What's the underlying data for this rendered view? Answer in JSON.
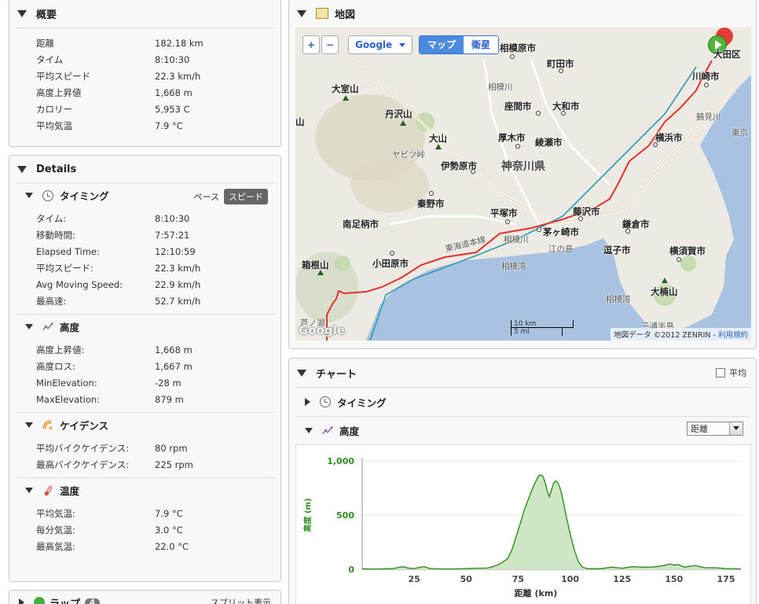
{
  "summary": {
    "title": "概要",
    "rows": [
      {
        "k": "距離",
        "v": "182.18 km"
      },
      {
        "k": "タイム",
        "v": "8:10:30"
      },
      {
        "k": "平均スピード",
        "v": "22.3 km/h"
      },
      {
        "k": "高度上昇値",
        "v": "1,668 m"
      },
      {
        "k": "カロリー",
        "v": "5,953 C"
      },
      {
        "k": "平均気温",
        "v": "7.9 °C"
      }
    ]
  },
  "details": {
    "title": "Details",
    "timing": {
      "name": "タイミング",
      "pace_label": "ペース",
      "speed_label": "スピード",
      "rows": [
        {
          "k": "タイム:",
          "v": "8:10:30"
        },
        {
          "k": "移動時間:",
          "v": "7:57:21"
        },
        {
          "k": "Elapsed Time:",
          "v": "12:10:59"
        },
        {
          "k": "平均スピード:",
          "v": "22.3 km/h"
        },
        {
          "k": "Avg Moving Speed:",
          "v": "22.9 km/h"
        },
        {
          "k": "最高速:",
          "v": "52.7 km/h"
        }
      ]
    },
    "elevation": {
      "name": "高度",
      "rows": [
        {
          "k": "高度上昇値:",
          "v": "1,668 m"
        },
        {
          "k": "高度ロス:",
          "v": "1,667 m"
        },
        {
          "k": "MinElevation:",
          "v": "-28 m"
        },
        {
          "k": "MaxElevation:",
          "v": "879 m"
        }
      ]
    },
    "cadence": {
      "name": "ケイデンス",
      "rows": [
        {
          "k": "平均バイクケイデンス:",
          "v": "80 rpm"
        },
        {
          "k": "最高バイクケイデンス:",
          "v": "225 rpm"
        }
      ]
    },
    "temperature": {
      "name": "温度",
      "rows": [
        {
          "k": "平均気温:",
          "v": "7.9 °C"
        },
        {
          "k": "毎分気温:",
          "v": "3.0 °C"
        },
        {
          "k": "最高気温:",
          "v": "22.0 °C"
        }
      ]
    }
  },
  "laps": {
    "name": "ラップ",
    "count": "4",
    "split_label": "スプリット表示"
  },
  "map": {
    "title": "地図",
    "zoom_in": "+",
    "zoom_out": "−",
    "provider": "Google",
    "type_map": "マップ",
    "type_satellite": "衛星",
    "scale_km": "10 km",
    "scale_mi": "5 mi",
    "attribution_prefix": "地図データ ©2012 ZENRIN - ",
    "attribution_terms": "利用規約",
    "logo": "Google",
    "labels": {
      "sagamihara": "相模原市",
      "machida": "町田市",
      "sagamigawa1": "相模川",
      "oomuroyama": "大室山",
      "zama": "座間市",
      "yamato": "大和市",
      "tanzawa": "丹沢山",
      "tsurumi": "鶴見川",
      "kawasaki": "川崎市",
      "ota": "大田区",
      "tokyo": "東京",
      "oyama": "大山",
      "atsugi": "厚木市",
      "ayase": "綾瀬市",
      "yokohama": "横浜市",
      "yabitsu": "ヤビツ峠",
      "isehara": "伊勢原市",
      "kanagawa": "神奈川県",
      "yama": "山",
      "hadano": "秦野市",
      "hiratsuka": "平塚市",
      "fujisawa": "藤沢市",
      "minamiashigara": "南足柄市",
      "chigasaki": "茅ヶ崎市",
      "kamakura": "鎌倉市",
      "tokaido": "東海道本線",
      "sagamigawa2": "相模川",
      "enoshima": "江の島",
      "zushi": "逗子市",
      "yokosuka": "横須賀市",
      "hakoneyama": "箱根山",
      "odawara": "小田原市",
      "sagamiwan1": "相模湾",
      "sagamiwan2": "相模湾",
      "ookusuyama": "大楠山",
      "ashinoko": "芦ノ湖",
      "miura": "三浦半島"
    }
  },
  "chart": {
    "title": "チャート",
    "avg_label": "平均",
    "timing_label": "タイミング",
    "elevation_label": "高度",
    "x_select": "距離"
  },
  "chart_data": {
    "type": "area",
    "xlabel": "距離 (km)",
    "ylabel": "高度 (m)",
    "xlim": [
      0,
      182.18
    ],
    "ylim": [
      0,
      1000
    ],
    "x_ticks": [
      25,
      50,
      75,
      100,
      125,
      150,
      175
    ],
    "y_ticks": [
      0,
      500,
      1000
    ],
    "y_tick_labels": [
      "0",
      "500",
      "1,000"
    ],
    "series": [
      {
        "color": "#2e8b1e",
        "fill": "#cfe6c4",
        "x": [
          0,
          5,
          10,
          15,
          18,
          20,
          22,
          25,
          28,
          30,
          32,
          35,
          38,
          40,
          45,
          50,
          55,
          60,
          62,
          65,
          67,
          70,
          72,
          74,
          76,
          78,
          80,
          82,
          84,
          85,
          86,
          87,
          88,
          89,
          90,
          91,
          92,
          93,
          94,
          95,
          96,
          97,
          98,
          100,
          102,
          104,
          106,
          108,
          110,
          115,
          120,
          125,
          130,
          135,
          140,
          145,
          148,
          150,
          152,
          155,
          158,
          160,
          165,
          170,
          175,
          180,
          182.18
        ],
        "y": [
          5,
          3,
          5,
          8,
          20,
          25,
          12,
          8,
          20,
          25,
          10,
          6,
          4,
          4,
          5,
          8,
          10,
          12,
          20,
          40,
          60,
          100,
          180,
          300,
          420,
          550,
          650,
          750,
          830,
          865,
          870,
          855,
          800,
          720,
          670,
          730,
          790,
          815,
          800,
          760,
          690,
          600,
          500,
          330,
          180,
          70,
          20,
          8,
          5,
          8,
          20,
          10,
          25,
          20,
          22,
          35,
          50,
          40,
          45,
          20,
          30,
          35,
          15,
          15,
          8,
          5,
          5
        ]
      }
    ]
  },
  "colors": {
    "route": "#e0322e",
    "rail": "#2a9bb0",
    "sea": "#a9c2e2",
    "chart_line": "#2e8b1e",
    "chart_fill": "#cfe6c4",
    "chart_axis": "#2e8b1e"
  }
}
